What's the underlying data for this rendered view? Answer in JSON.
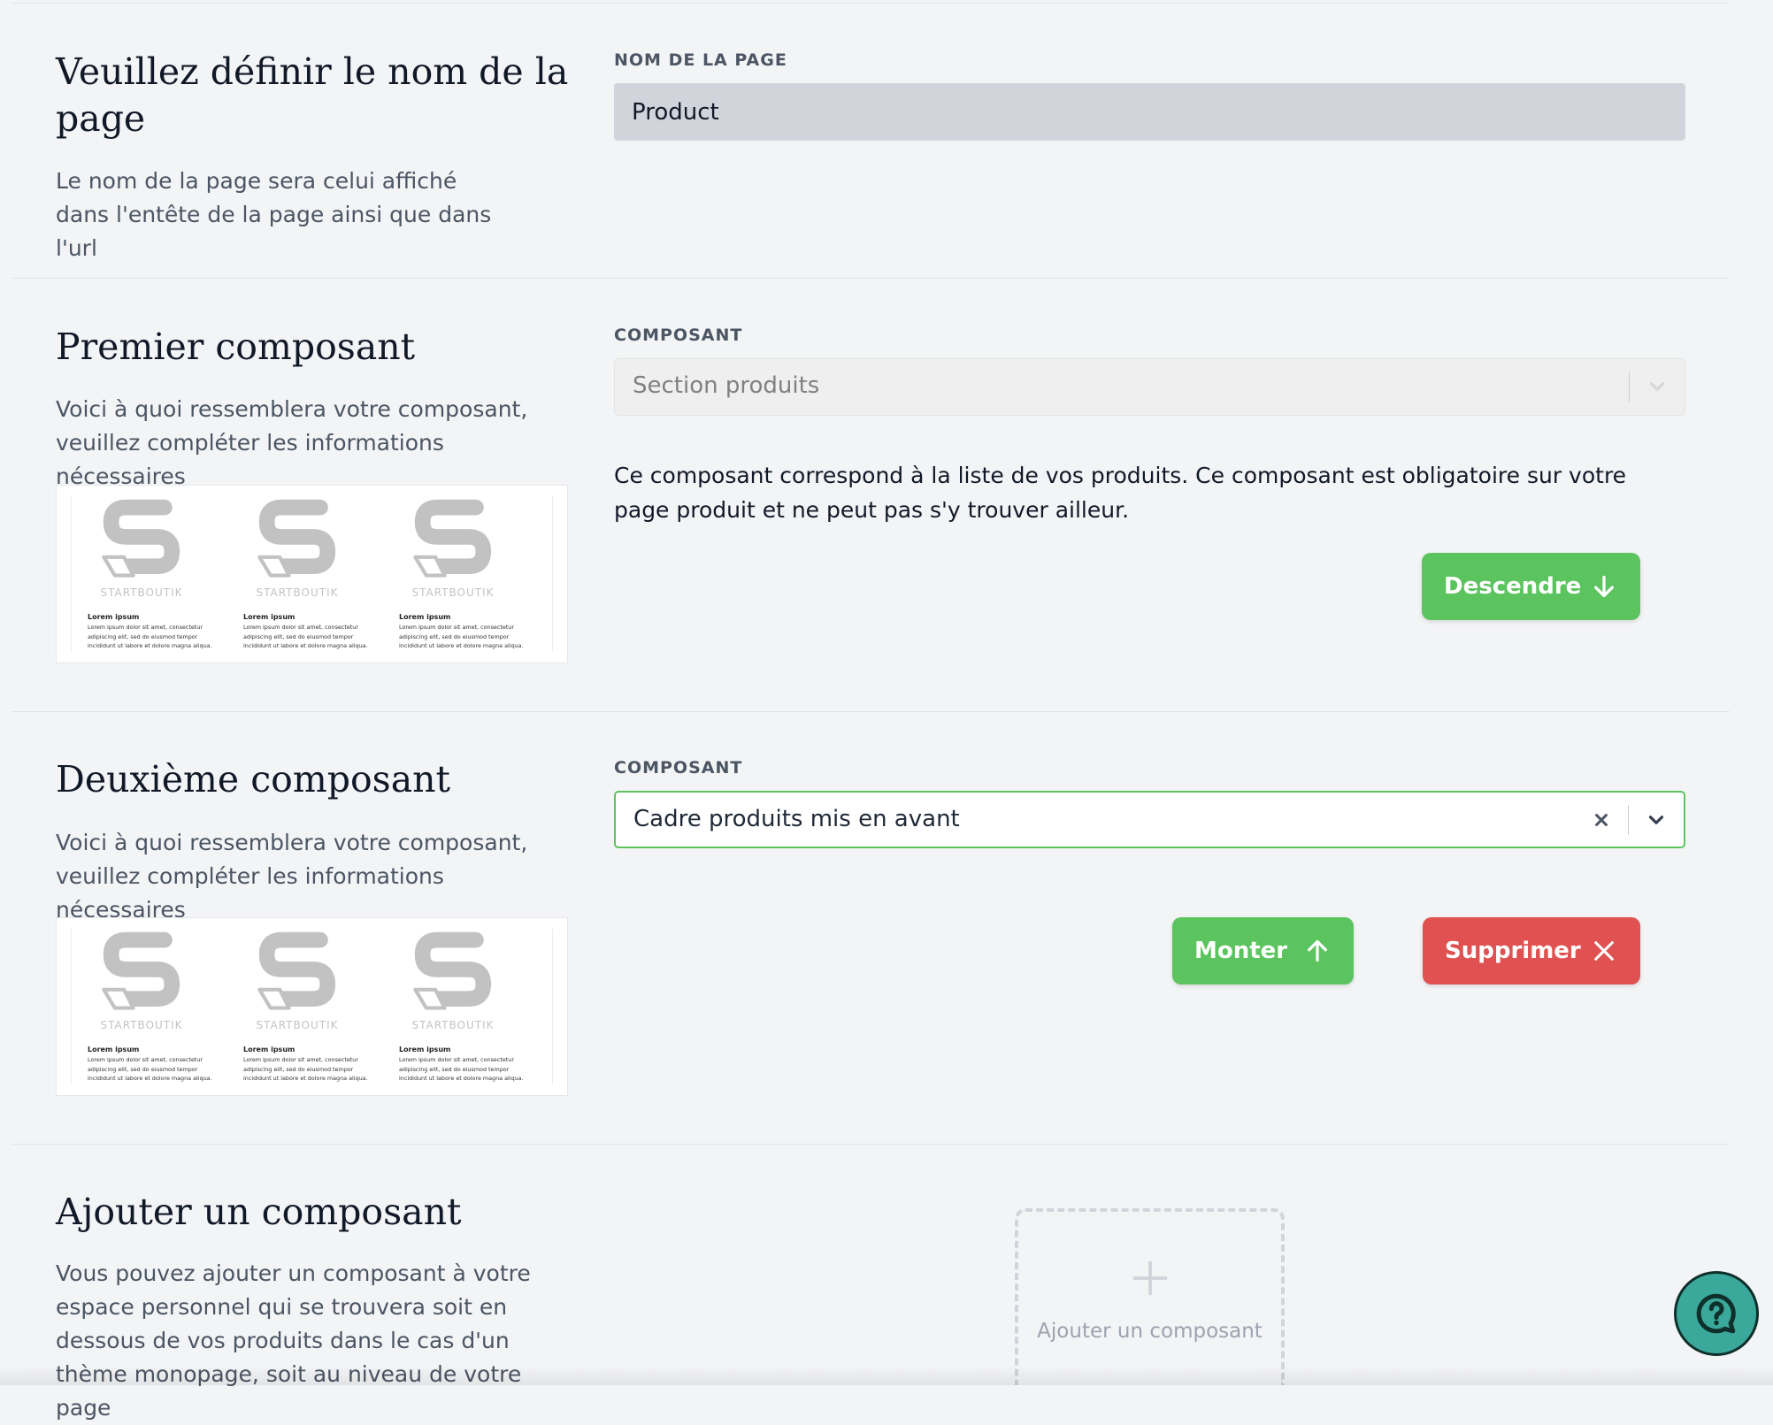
{
  "page_name_section": {
    "title": "Veuillez définir le nom de la page",
    "description": "Le nom de la page sera celui affiché dans l'entête de la page ainsi que dans l'url",
    "field_label": "NOM DE LA PAGE",
    "field_value": "Product"
  },
  "first_component": {
    "title": "Premier composant",
    "description": "Voici à quoi ressemblera votre composant, veuillez compléter les informations nécessaires",
    "field_label": "COMPOSANT",
    "selected": "Section produits",
    "info": "Ce composant correspond à la liste de vos produits. Ce composant est obligatoire sur votre page produit et ne peut pas s'y trouver ailleur.",
    "down_button": "Descendre"
  },
  "second_component": {
    "title": "Deuxième composant",
    "description": "Voici à quoi ressemblera votre composant, veuillez compléter les informations nécessaires",
    "field_label": "COMPOSANT",
    "selected": "Cadre produits mis en avant",
    "up_button": "Monter",
    "delete_button": "Supprimer"
  },
  "preview_card": {
    "brand": "STARTBOUTIK",
    "title": "Lorem ipsum",
    "body": "Lorem ipsum dolor sit amet, consectetur adipiscing elit, sed do eiusmod tempor incididunt ut labore et dolore magna aliqua."
  },
  "add_section": {
    "title": "Ajouter un composant",
    "description": "Vous pouvez ajouter un composant à votre espace personnel qui se trouvera soit en dessous de vos produits dans le cas d'un thème monopage, soit au niveau de votre page",
    "add_label": "Ajouter un composant"
  },
  "colors": {
    "accent_green": "#5cc45f",
    "danger_red": "#e05252",
    "help_teal": "#3aa89a"
  },
  "icons": [
    "arrow-down-icon",
    "arrow-up-icon",
    "close-icon",
    "chevron-down-icon",
    "plus-icon",
    "help-chat-icon",
    "startboutik-logo"
  ]
}
